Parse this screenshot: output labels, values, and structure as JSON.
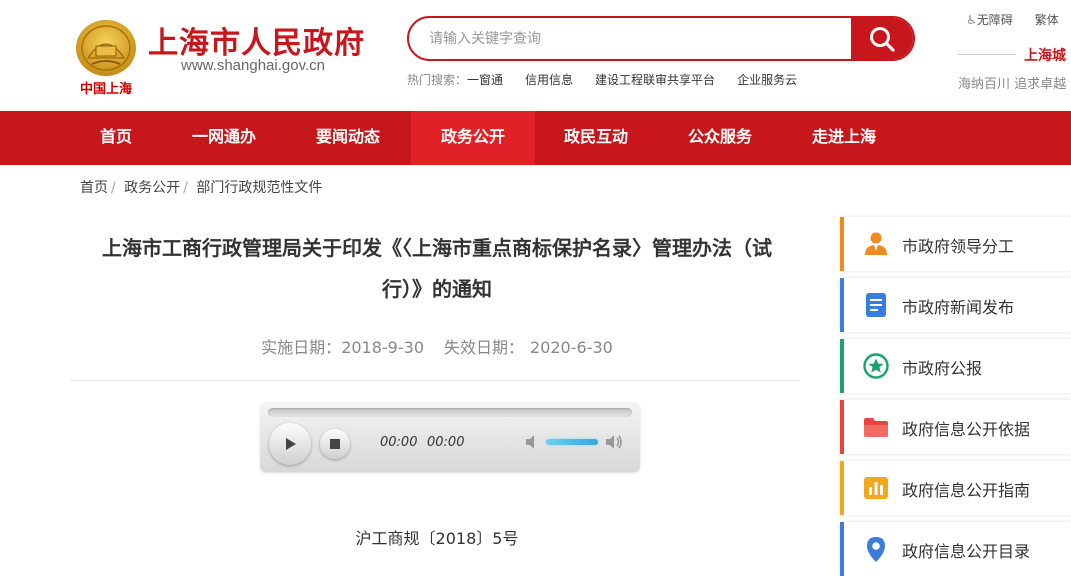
{
  "header": {
    "logo_text": "中国上海",
    "site_title": "上海市人民政府",
    "site_url": "www.shanghai.gov.cn",
    "search_placeholder": "请输入关键字查询",
    "hot_label": "热门搜索：",
    "hot_keywords": [
      "一窗通",
      "信用信息",
      "建设工程联审共享平台",
      "企业服务云"
    ],
    "accessibility": "无障碍",
    "traditional": "繁体",
    "city_link": "上海城",
    "slogan": "海纳百川 追求卓越"
  },
  "nav": {
    "items": [
      "首页",
      "一网通办",
      "要闻动态",
      "政务公开",
      "政民互动",
      "公众服务",
      "走进上海"
    ],
    "active": "政务公开"
  },
  "breadcrumb": [
    "首页",
    "政务公开",
    "部门行政规范性文件"
  ],
  "article": {
    "title_line1": "上海市工商行政管理局关于印发《〈上海市重点商标保护名录〉管理办法（试",
    "title_line2": "行）》的通知",
    "effective_label": "实施日期：",
    "effective_date": "2018-9-30",
    "expiry_label": "失效日期：",
    "expiry_date": "2020-6-30",
    "doc_number": "沪工商规〔2018〕5号"
  },
  "player": {
    "current_time": "00:00",
    "duration": "00:00",
    "progress": 0,
    "volume": 0.8
  },
  "sidebar": {
    "items": [
      {
        "label": "市政府领导分工",
        "color": "#f08a1d",
        "icon": "leader-icon"
      },
      {
        "label": "市政府新闻发布",
        "color": "#3b7ddd",
        "icon": "document-icon"
      },
      {
        "label": "市政府公报",
        "color": "#1aa36b",
        "icon": "star-circle-icon"
      },
      {
        "label": "政府信息公开依据",
        "color": "#e8433f",
        "icon": "folder-icon"
      },
      {
        "label": "政府信息公开指南",
        "color": "#f2a81d",
        "icon": "chart-icon"
      },
      {
        "label": "政府信息公开目录",
        "color": "#3b7ddd",
        "icon": "location-pin-icon"
      }
    ]
  }
}
